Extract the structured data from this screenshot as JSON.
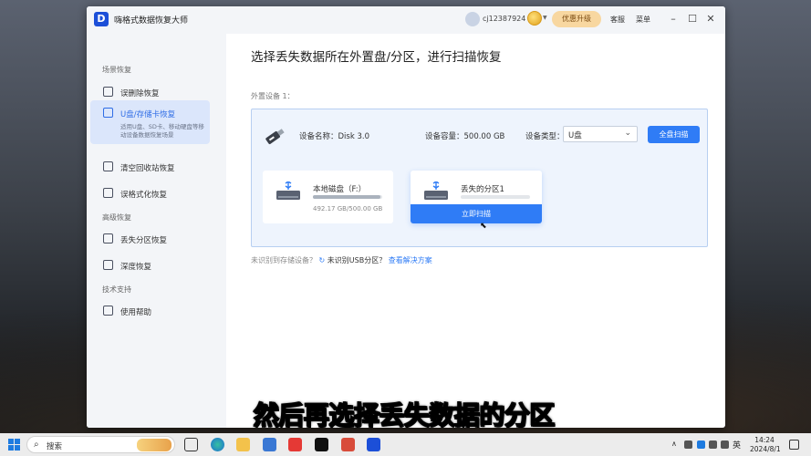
{
  "app": {
    "title": "嗨格式数据恢复大师",
    "logo_letter": "D"
  },
  "header": {
    "user_id": "cj12387924",
    "upgrade_label": "优惠升级",
    "service_label": "客服",
    "menu_label": "菜单"
  },
  "sidebar": {
    "section_scene": "场景恢复",
    "section_advanced": "高级恢复",
    "section_support": "技术支持",
    "items": {
      "mistake_delete": "误删除恢复",
      "usb_card": "U盘/存储卡恢复",
      "usb_card_desc": "适用U盘、SD卡、移动硬盘等移动设备数据恢复场景",
      "recycle": "清空回收站恢复",
      "format": "误格式化恢复",
      "lost_partition": "丢失分区恢复",
      "deep": "深度恢复",
      "help": "使用帮助"
    }
  },
  "main": {
    "heading": "选择丢失数据所在外置盘/分区，进行扫描恢复",
    "external_label": "外置设备 1：",
    "device": {
      "name": "设备名称：Disk 3.0",
      "capacity": "设备容量：500.00 GB",
      "type_label": "设备类型：",
      "type_value": "U盘",
      "full_scan": "全盘扫描"
    },
    "partitions": [
      {
        "title": "本地磁盘（F:）",
        "size": "492.17 GB/500.00 GB",
        "used_fraction": 0.98
      },
      {
        "title": "丢失的分区1",
        "scan_label": "立即扫描"
      }
    ],
    "unrecognized": {
      "question": "未识别到存储设备？",
      "usb_question": "未识别USB分区？",
      "link": "查看解决方案"
    }
  },
  "subtitle": "然后再选择丢失数据的分区",
  "taskbar": {
    "search_placeholder": "搜索",
    "ime": "英",
    "time": "14:24",
    "date": "2024/8/1"
  },
  "colors": {
    "accent": "#2f7cf6",
    "brand": "#1c4fd8",
    "upgrade_bg": "#f8d7a0"
  }
}
